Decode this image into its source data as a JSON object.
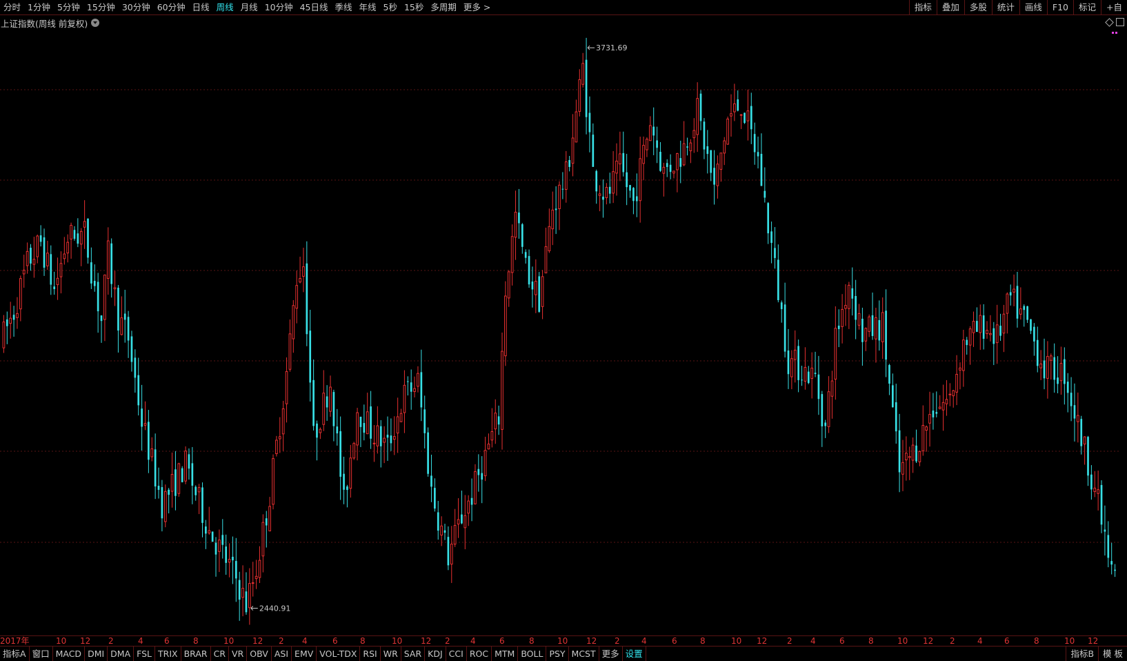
{
  "period_tabs": [
    {
      "label": "分时",
      "active": false
    },
    {
      "label": "1分钟",
      "active": false
    },
    {
      "label": "5分钟",
      "active": false
    },
    {
      "label": "15分钟",
      "active": false
    },
    {
      "label": "30分钟",
      "active": false
    },
    {
      "label": "60分钟",
      "active": false
    },
    {
      "label": "日线",
      "active": false
    },
    {
      "label": "周线",
      "active": true
    },
    {
      "label": "月线",
      "active": false
    },
    {
      "label": "10分钟",
      "active": false
    },
    {
      "label": "45日线",
      "active": false
    },
    {
      "label": "季线",
      "active": false
    },
    {
      "label": "年线",
      "active": false
    },
    {
      "label": "5秒",
      "active": false
    },
    {
      "label": "15秒",
      "active": false
    },
    {
      "label": "多周期",
      "active": false
    },
    {
      "label": "更多 >",
      "active": false
    }
  ],
  "tools": [
    "指标",
    "叠加",
    "多股",
    "统计",
    "画线",
    "F10",
    "标记",
    "+自"
  ],
  "chart_title": "上证指数(周线 前复权)",
  "indicator_tabs": [
    {
      "label": "指标A",
      "active": false
    },
    {
      "label": "窗口",
      "active": false
    },
    {
      "label": "MACD",
      "active": false
    },
    {
      "label": "DMI",
      "active": false
    },
    {
      "label": "DMA",
      "active": false
    },
    {
      "label": "FSL",
      "active": false
    },
    {
      "label": "TRIX",
      "active": false
    },
    {
      "label": "BRAR",
      "active": false
    },
    {
      "label": "CR",
      "active": false
    },
    {
      "label": "VR",
      "active": false
    },
    {
      "label": "OBV",
      "active": false
    },
    {
      "label": "ASI",
      "active": false
    },
    {
      "label": "EMV",
      "active": false
    },
    {
      "label": "VOL-TDX",
      "active": false
    },
    {
      "label": "RSI",
      "active": false
    },
    {
      "label": "WR",
      "active": false
    },
    {
      "label": "SAR",
      "active": false
    },
    {
      "label": "KDJ",
      "active": false
    },
    {
      "label": "CCI",
      "active": false
    },
    {
      "label": "ROC",
      "active": false
    },
    {
      "label": "MTM",
      "active": false
    },
    {
      "label": "BOLL",
      "active": false
    },
    {
      "label": "PSY",
      "active": false
    },
    {
      "label": "MCST",
      "active": false
    },
    {
      "label": "更多",
      "active": false
    },
    {
      "label": "设置",
      "active": true
    }
  ],
  "bottom_right_tabs": [
    "指标B",
    "模 板"
  ],
  "colors": {
    "up": "#e83030",
    "down": "#38e0e6",
    "grid": "#5a1414",
    "axis_text": "#e03434",
    "active_tab": "#33e6f0",
    "background": "#000000"
  },
  "chart_data": {
    "type": "candlestick",
    "xlabel": "",
    "ylabel": "",
    "ylim": [
      2380,
      3800
    ],
    "grid": true,
    "series_anchors": [
      [
        0,
        3050
      ],
      [
        4,
        3120
      ],
      [
        8,
        3230
      ],
      [
        12,
        3280
      ],
      [
        16,
        3170
      ],
      [
        20,
        3290
      ],
      [
        25,
        3300
      ],
      [
        30,
        3100
      ],
      [
        32,
        3250
      ],
      [
        35,
        3110
      ],
      [
        38,
        3060
      ],
      [
        42,
        2870
      ],
      [
        48,
        2680
      ],
      [
        55,
        2770
      ],
      [
        62,
        2620
      ],
      [
        70,
        2510
      ],
      [
        73,
        2450
      ],
      [
        76,
        2530
      ],
      [
        80,
        2700
      ],
      [
        85,
        2980
      ],
      [
        88,
        3200
      ],
      [
        90,
        3230
      ],
      [
        93,
        2830
      ],
      [
        98,
        2960
      ],
      [
        102,
        2680
      ],
      [
        106,
        2900
      ],
      [
        110,
        2850
      ],
      [
        115,
        2810
      ],
      [
        120,
        2930
      ],
      [
        124,
        2960
      ],
      [
        128,
        2710
      ],
      [
        133,
        2560
      ],
      [
        137,
        2650
      ],
      [
        140,
        2700
      ],
      [
        144,
        2790
      ],
      [
        148,
        2880
      ],
      [
        150,
        3170
      ],
      [
        153,
        3340
      ],
      [
        156,
        3220
      ],
      [
        160,
        3150
      ],
      [
        164,
        3360
      ],
      [
        168,
        3430
      ],
      [
        173,
        3680
      ],
      [
        176,
        3440
      ],
      [
        180,
        3380
      ],
      [
        184,
        3450
      ],
      [
        188,
        3370
      ],
      [
        193,
        3560
      ],
      [
        197,
        3440
      ],
      [
        202,
        3480
      ],
      [
        207,
        3580
      ],
      [
        212,
        3400
      ],
      [
        216,
        3560
      ],
      [
        220,
        3600
      ],
      [
        225,
        3470
      ],
      [
        230,
        3220
      ],
      [
        234,
        3010
      ],
      [
        238,
        2990
      ],
      [
        242,
        2970
      ],
      [
        245,
        2850
      ],
      [
        248,
        3060
      ],
      [
        252,
        3190
      ],
      [
        256,
        3070
      ],
      [
        262,
        3090
      ],
      [
        267,
        2750
      ],
      [
        272,
        2810
      ],
      [
        277,
        2900
      ],
      [
        282,
        2920
      ],
      [
        286,
        3050
      ],
      [
        292,
        3090
      ],
      [
        296,
        3060
      ],
      [
        300,
        3150
      ],
      [
        305,
        3090
      ],
      [
        310,
        2990
      ],
      [
        316,
        2980
      ],
      [
        320,
        2860
      ],
      [
        325,
        2720
      ],
      [
        330,
        2520
      ]
    ],
    "high": {
      "value": 3731.69,
      "label": "3731.69"
    },
    "low": {
      "value": 2440.91,
      "label": "2440.91"
    },
    "x_axis_labels": [
      {
        "text": "2017年",
        "x": 0
      },
      {
        "text": "10",
        "x": 81
      },
      {
        "text": "12",
        "x": 116
      },
      {
        "text": "2",
        "x": 157
      },
      {
        "text": "4",
        "x": 200
      },
      {
        "text": "6",
        "x": 238
      },
      {
        "text": "8",
        "x": 280
      },
      {
        "text": "10",
        "x": 324
      },
      {
        "text": "12",
        "x": 366
      },
      {
        "text": "2",
        "x": 404
      },
      {
        "text": "4",
        "x": 438
      },
      {
        "text": "6",
        "x": 482
      },
      {
        "text": "8",
        "x": 522
      },
      {
        "text": "10",
        "x": 568
      },
      {
        "text": "12",
        "x": 610
      },
      {
        "text": "2",
        "x": 645
      },
      {
        "text": "4",
        "x": 682
      },
      {
        "text": "6",
        "x": 724
      },
      {
        "text": "8",
        "x": 767
      },
      {
        "text": "10",
        "x": 808
      },
      {
        "text": "12",
        "x": 850
      },
      {
        "text": "2",
        "x": 891
      },
      {
        "text": "4",
        "x": 930
      },
      {
        "text": "6",
        "x": 974
      },
      {
        "text": "8",
        "x": 1015
      },
      {
        "text": "10",
        "x": 1060
      },
      {
        "text": "12",
        "x": 1097
      },
      {
        "text": "2",
        "x": 1141
      },
      {
        "text": "4",
        "x": 1175
      },
      {
        "text": "6",
        "x": 1217
      },
      {
        "text": "8",
        "x": 1259
      },
      {
        "text": "10",
        "x": 1301
      },
      {
        "text": "12",
        "x": 1338
      },
      {
        "text": "2",
        "x": 1377
      },
      {
        "text": "4",
        "x": 1417
      },
      {
        "text": "6",
        "x": 1456
      },
      {
        "text": "8",
        "x": 1499
      },
      {
        "text": "10",
        "x": 1543
      },
      {
        "text": "12",
        "x": 1577
      }
    ]
  }
}
